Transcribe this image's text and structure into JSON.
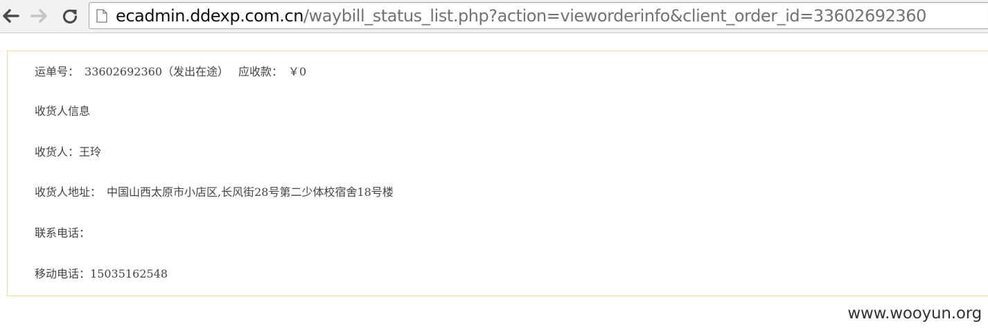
{
  "browser": {
    "url_host": "ecadmin.ddexp.com.cn",
    "url_path": "/waybill_status_list.php?action=vieworderinfo&client_order_id=33602692360",
    "back_icon": "arrow-left-icon",
    "forward_icon": "arrow-right-icon",
    "reload_icon": "reload-icon",
    "page_icon": "page-icon"
  },
  "order": {
    "waybill_label": "运单号：",
    "waybill_value": "33602692360（发出在途）",
    "amount_label": "应收款：",
    "amount_value": "￥0",
    "section_title": "收货人信息",
    "receiver_label": "收货人：",
    "receiver_value": "王玲",
    "address_label": "收货人地址：",
    "address_value": "中国山西太原市小店区,长风街28号第二少体校宿舍18号楼",
    "phone_label": "联系电话：",
    "phone_value": "",
    "mobile_label": "移动电话：",
    "mobile_value": "15035162548"
  },
  "watermark": "www.wooyun.org",
  "colors": {
    "box_border": "#f3dc8a",
    "text": "#444444",
    "url_path": "#727272"
  }
}
